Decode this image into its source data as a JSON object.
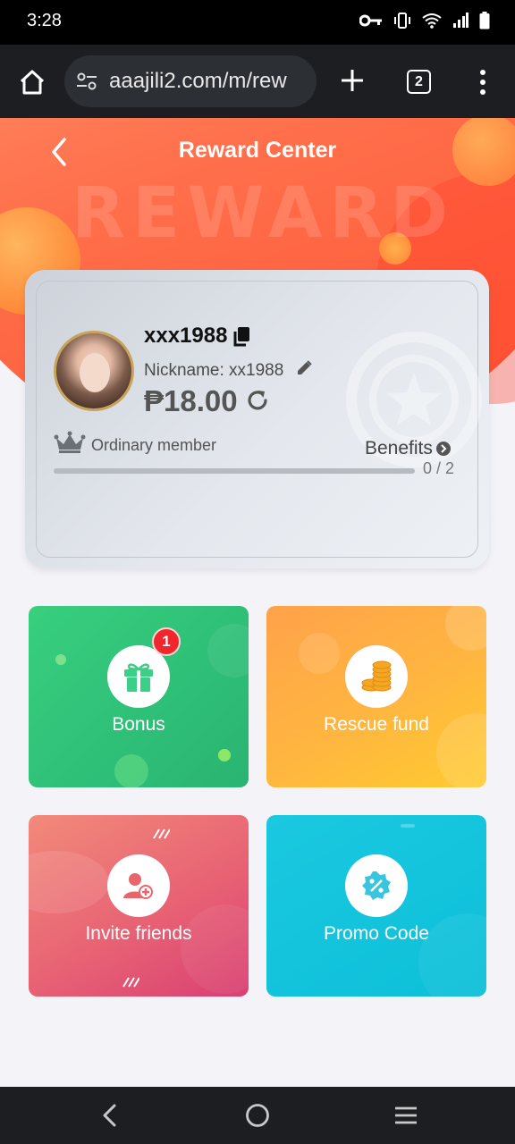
{
  "status_bar": {
    "time": "3:28"
  },
  "browser": {
    "url": "aaajili2.com/m/rew",
    "tab_count": "2"
  },
  "header": {
    "title": "Reward Center",
    "watermark": "REWARD"
  },
  "member_card": {
    "username": "xxx1988",
    "nickname": "Nickname: xx1988",
    "balance": "₱18.00",
    "level": "Ordinary member",
    "benefits_label": "Benefits",
    "progress_label": "0 / 2",
    "progress_fraction": 0
  },
  "tiles": [
    {
      "label": "Bonus",
      "badge": "1",
      "icon": "gift-icon"
    },
    {
      "label": "Rescue fund",
      "icon": "coins-icon"
    },
    {
      "label": "Invite friends",
      "icon": "add-user-icon"
    },
    {
      "label": "Promo Code",
      "icon": "percent-coupon-icon"
    }
  ],
  "colors": {
    "header_orange": "#ff6f4b",
    "bonus_green": "#2fc078",
    "rescue_orange": "#ffb640",
    "invite_pink": "#e86374",
    "promo_cyan": "#0ebfd9",
    "badge_red": "#f0282d"
  }
}
